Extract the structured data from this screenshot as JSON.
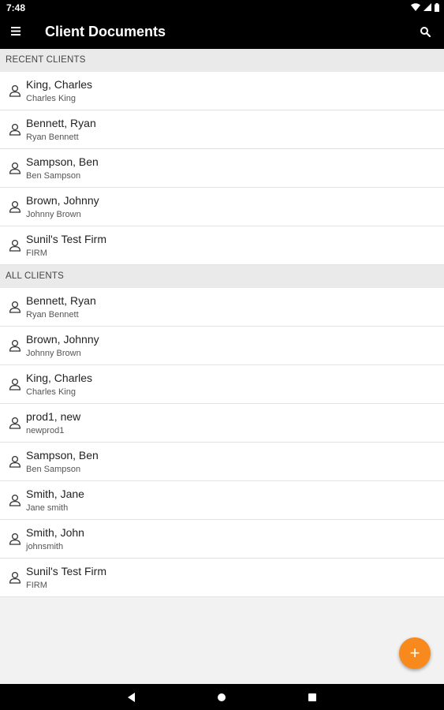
{
  "status": {
    "time": "7:48",
    "icons": [
      "wifi-icon",
      "signal-icon",
      "battery-icon"
    ]
  },
  "appbar": {
    "title": "Client Documents",
    "menu_icon": "menu-icon",
    "search_icon": "search-icon"
  },
  "recent": {
    "header": "RECENT CLIENTS",
    "items": [
      {
        "name": "King, Charles",
        "sub": "Charles King"
      },
      {
        "name": "Bennett, Ryan",
        "sub": "Ryan Bennett"
      },
      {
        "name": "Sampson, Ben",
        "sub": "Ben Sampson"
      },
      {
        "name": "Brown, Johnny",
        "sub": "Johnny Brown"
      },
      {
        "name": "Sunil's Test Firm",
        "sub": "FIRM"
      }
    ]
  },
  "all": {
    "header": "ALL CLIENTS",
    "items": [
      {
        "name": "Bennett, Ryan",
        "sub": "Ryan Bennett"
      },
      {
        "name": "Brown, Johnny",
        "sub": "Johnny Brown"
      },
      {
        "name": "King, Charles",
        "sub": "Charles King"
      },
      {
        "name": "prod1, new",
        "sub": "newprod1"
      },
      {
        "name": "Sampson, Ben",
        "sub": "Ben Sampson"
      },
      {
        "name": "Smith, Jane",
        "sub": "Jane smith"
      },
      {
        "name": "Smith, John",
        "sub": "johnsmith"
      },
      {
        "name": "Sunil's Test Firm",
        "sub": "FIRM"
      }
    ]
  },
  "fab": {
    "label": "+",
    "icon": "add-icon",
    "color": "#f7891d"
  },
  "navbar": {
    "icons": [
      "back-icon",
      "home-icon",
      "recents-icon"
    ]
  }
}
